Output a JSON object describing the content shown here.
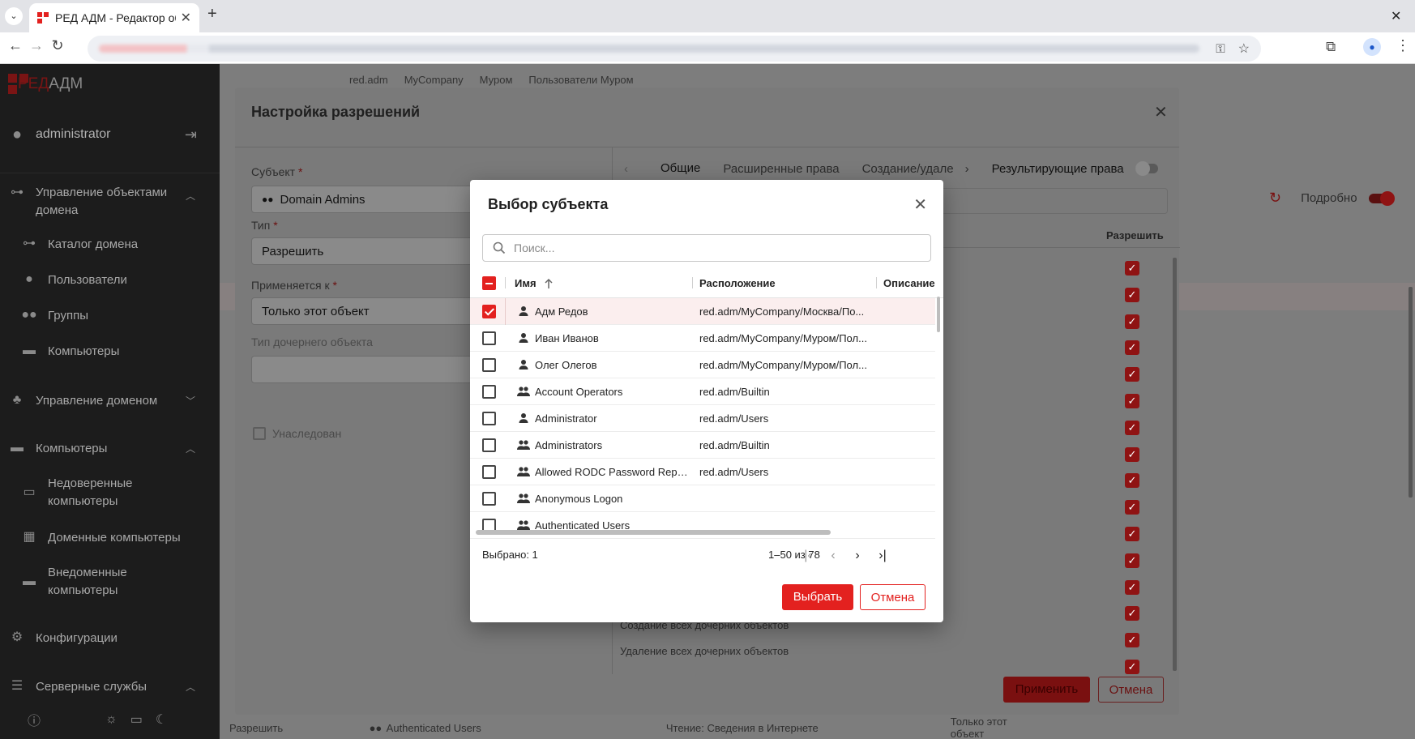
{
  "browser": {
    "tab_title": "РЕД АДМ - Редактор об",
    "new_tab": "+",
    "window_close": "✕"
  },
  "sidebar": {
    "logo_red": "РЕД",
    "logo_white": "АДМ",
    "user": "administrator",
    "items": [
      {
        "label": "Управление объектами домена",
        "line1": "Управление объектами",
        "line2": "домена"
      },
      {
        "label": "Каталог домена"
      },
      {
        "label": "Пользователи"
      },
      {
        "label": "Группы"
      },
      {
        "label": "Компьютеры"
      },
      {
        "label": "Управление доменом"
      },
      {
        "label": "Компьютеры"
      },
      {
        "line1": "Недоверенные",
        "line2": "компьютеры"
      },
      {
        "label": "Доменные компьютеры"
      },
      {
        "line1": "Внедоменные",
        "line2": "компьютеры"
      },
      {
        "label": "Конфигурации"
      },
      {
        "label": "Серверные службы"
      }
    ]
  },
  "background": {
    "breadcrumb": [
      "red.adm",
      "MyCompany",
      "Муром",
      "Пользователи Муром"
    ],
    "details_label": "Подробно",
    "bottom_row": [
      "Разрешить",
      "Authenticated Users",
      "Чтение: Сведения в Интернете",
      "Только этот объект"
    ]
  },
  "perm_dialog": {
    "title": "Настройка разрешений",
    "subject_label": "Субъект",
    "subject_value": "Domain Admins",
    "type_label": "Тип",
    "type_value": "Разрешить",
    "applies_label": "Применяется к",
    "applies_value": "Только этот объект",
    "child_type_label": "Тип дочернего объекта",
    "inherited_label": "Унаследован",
    "tabs": [
      "Общие",
      "Расширенные права",
      "Создание/удале"
    ],
    "result_rights": "Результирующие права",
    "allow_col": "Разрешить",
    "rights": [
      "Создание всех дочерних объектов",
      "Удаление всех дочерних объектов"
    ],
    "apply": "Применить",
    "cancel": "Отмена"
  },
  "modal": {
    "title": "Выбор субъекта",
    "search_placeholder": "Поиск...",
    "columns": {
      "name": "Имя",
      "location": "Расположение",
      "description": "Описание"
    },
    "rows": [
      {
        "name": "Адм Редов",
        "location": "red.adm/MyCompany/Москва/По...",
        "kind": "user",
        "checked": true
      },
      {
        "name": "Иван Иванов",
        "location": "red.adm/MyCompany/Муром/Пол...",
        "kind": "user",
        "checked": false
      },
      {
        "name": "Олег Олегов",
        "location": "red.adm/MyCompany/Муром/Пол...",
        "kind": "user",
        "checked": false
      },
      {
        "name": "Account Operators",
        "location": "red.adm/Builtin",
        "kind": "group",
        "checked": false
      },
      {
        "name": "Administrator",
        "location": "red.adm/Users",
        "kind": "user",
        "checked": false
      },
      {
        "name": "Administrators",
        "location": "red.adm/Builtin",
        "kind": "group",
        "checked": false
      },
      {
        "name": "Allowed RODC Password Repli...",
        "location": "red.adm/Users",
        "kind": "group",
        "checked": false
      },
      {
        "name": "Anonymous Logon",
        "location": "",
        "kind": "group",
        "checked": false
      },
      {
        "name": "Authenticated Users",
        "location": "",
        "kind": "group",
        "checked": false
      }
    ],
    "selected_count": "Выбрано: 1",
    "page_range": "1–50 из 78",
    "select_button": "Выбрать",
    "cancel_button": "Отмена"
  },
  "colors": {
    "accent": "#e3211f",
    "sidebar": "#1c1c1c"
  }
}
